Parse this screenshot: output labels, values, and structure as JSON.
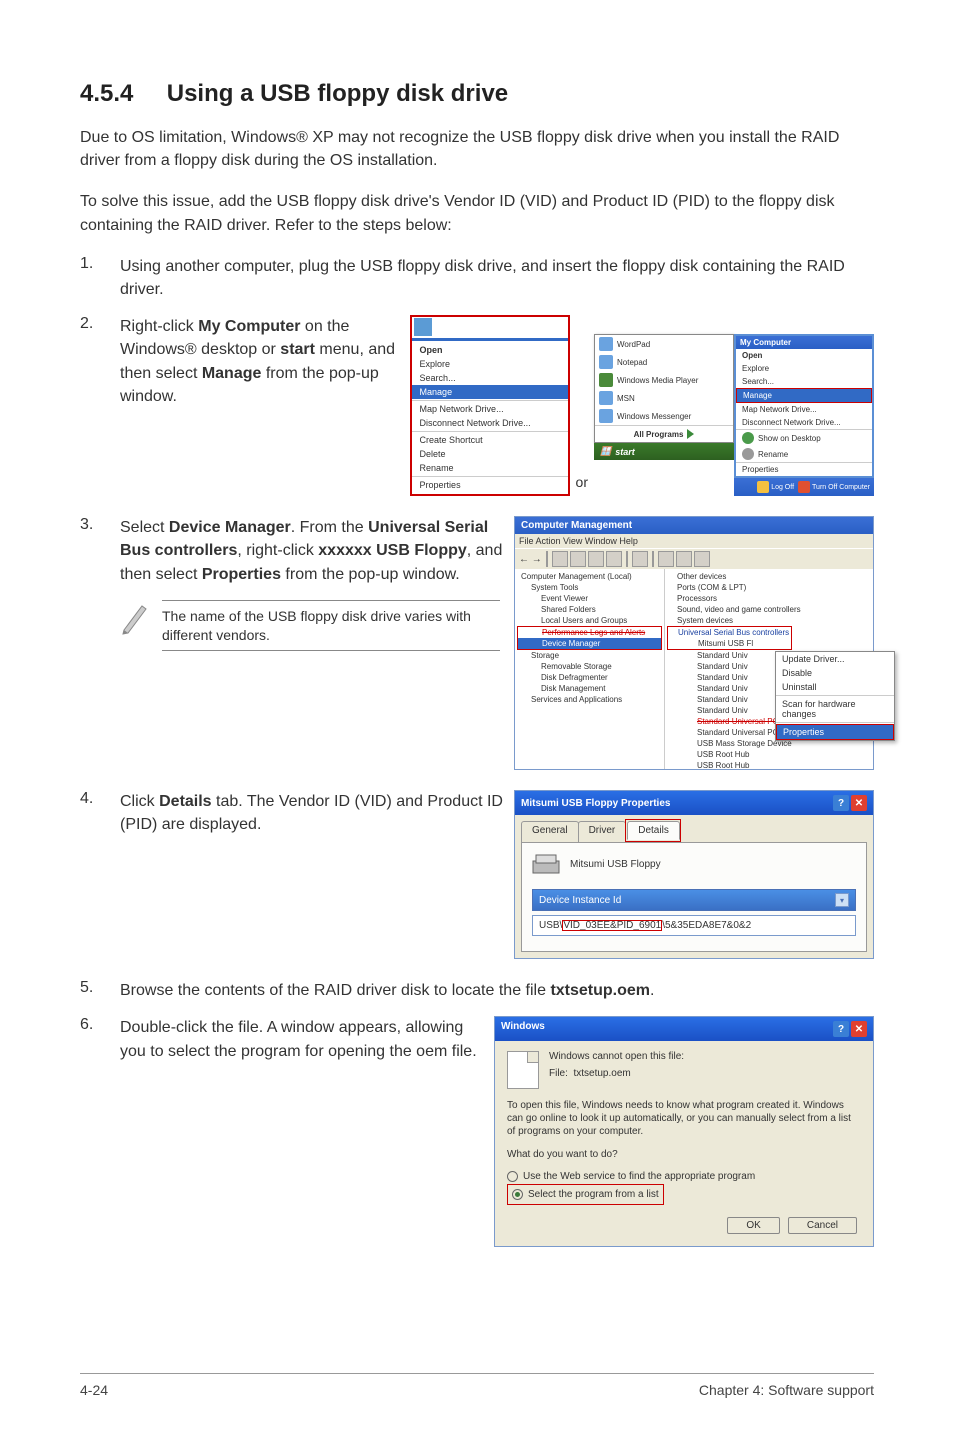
{
  "heading_num": "4.5.4",
  "heading_txt": "Using a USB floppy disk drive",
  "intro1": "Due to OS limitation, Windows® XP may not recognize the USB floppy disk drive when you install the RAID driver from a floppy disk during the OS installation.",
  "intro2": "To solve this issue, add the USB floppy disk drive's Vendor ID (VID) and Product ID (PID) to the floppy disk containing the RAID driver. Refer to the steps below:",
  "steps": {
    "s1": {
      "n": "1.",
      "t": "Using another computer, plug the USB floppy disk drive, and insert the floppy disk containing the RAID driver."
    },
    "s2": {
      "n": "2.",
      "t_pre": "Right-click ",
      "b1": "My Computer",
      "t_mid": " on the Windows® desktop or ",
      "b2": "start",
      "t_mid2": " menu, and then select ",
      "b3": "Manage",
      "t_end": " from the pop-up window."
    },
    "s3": {
      "n": "3.",
      "t_pre": "Select ",
      "b1": "Device Manager",
      "t_mid": ". From the ",
      "b2": "Universal Serial Bus controllers",
      "t_mid2": ", right-click ",
      "b3": "xxxxxx USB Floppy",
      "t_mid3": ", and then select ",
      "b4": "Properties",
      "t_end": " from the pop-up window."
    },
    "s4": {
      "n": "4.",
      "t_pre": "Click ",
      "b1": "Details",
      "t_end": " tab. The Vendor ID (VID) and Product ID (PID) are displayed."
    },
    "s5": {
      "n": "5.",
      "t_pre": "Browse the contents of the RAID driver disk to locate the file ",
      "b1": "txtsetup.oem",
      "t_end": "."
    },
    "s6": {
      "n": "6.",
      "t": "Double-click the file. A window appears, allowing you to select the program for opening the oem file."
    }
  },
  "note": "The name of the USB floppy disk drive varies with different vendors.",
  "or": "or",
  "menu1": {
    "open": "Open",
    "explore": "Explore",
    "search": "Search...",
    "manage": "Manage",
    "mapnet": "Map Network Drive...",
    "discnet": "Disconnect Network Drive...",
    "shortcut": "Create Shortcut",
    "delete": "Delete",
    "rename": "Rename",
    "props": "Properties"
  },
  "startmenu": {
    "wordpad": "WordPad",
    "notepad": "Notepad",
    "wmp": "Windows Media Player",
    "msn": "MSN",
    "wmsg": "Windows Messenger",
    "allprog": "All Programs",
    "start": "start"
  },
  "menu3": {
    "title": "My Computer",
    "open": "Open",
    "explore": "Explore",
    "search": "Search...",
    "manage": "Manage",
    "mapnet": "Map Network Drive...",
    "discnet": "Disconnect Network Drive...",
    "showdesk": "Show on Desktop",
    "rename": "Rename",
    "props": "Properties",
    "logoff": "Log Off",
    "turnoff": "Turn Off Computer"
  },
  "devmgr": {
    "title": "Computer Management",
    "menu": "File   Action   View   Window   Help",
    "left": {
      "root": "Computer Management (Local)",
      "systools": "System Tools",
      "ev": "Event Viewer",
      "sf": "Shared Folders",
      "lu": "Local Users and Groups",
      "perf": "Performance Logs and Alerts",
      "dm": "Device Manager",
      "storage": "Storage",
      "rs": "Removable Storage",
      "dd": "Disk Defragmenter",
      "dmg": "Disk Management",
      "sa": "Services and Applications"
    },
    "right": {
      "other": "Other devices",
      "ports": "Ports (COM & LPT)",
      "proc": "Processors",
      "svid": "Sound, video and game controllers",
      "sysd": "System devices",
      "usb": "Universal Serial Bus controllers",
      "musb": "Mitsumi USB Fl",
      "su1": "Standard Univ",
      "su2": "Standard Univ",
      "su3": "Standard Univ",
      "su4": "Standard Univ",
      "su5": "Standard Univ",
      "su6": "Standard Univ",
      "supci": "Standard Universal PCI to USB Host Controller",
      "supci2": "Standard Universal PCI to USB Host Controller",
      "umass": "USB Mass Storage Device",
      "uroot": "USB Root Hub",
      "uroot2": "USB Root Hub"
    },
    "ctx": {
      "upd": "Update Driver...",
      "dis": "Disable",
      "uni": "Uninstall",
      "scan": "Scan for hardware changes",
      "props": "Properties"
    }
  },
  "propdlg": {
    "title": "Mitsumi USB Floppy Properties",
    "tab_general": "General",
    "tab_driver": "Driver",
    "tab_details": "Details",
    "devname": "Mitsumi USB Floppy",
    "combo": "Device Instance Id",
    "id_pre": "USB\\",
    "id_red": "VID_03EE&PID_6901",
    "id_post": "\\5&35EDA8E7&0&2"
  },
  "windlg": {
    "title": "Windows",
    "cannot": "Windows cannot open this file:",
    "flabel": "File:",
    "fname": "txtsetup.oem",
    "explain": "To open this file, Windows needs to know what program created it.  Windows can go online to look it up automatically, or you can manually select from a list of programs on your computer.",
    "what": "What do you want to do?",
    "r1": "Use the Web service to find the appropriate program",
    "r2": "Select the program from a list",
    "ok": "OK",
    "cancel": "Cancel"
  },
  "footer_left": "4-24",
  "footer_right": "Chapter 4: Software support"
}
